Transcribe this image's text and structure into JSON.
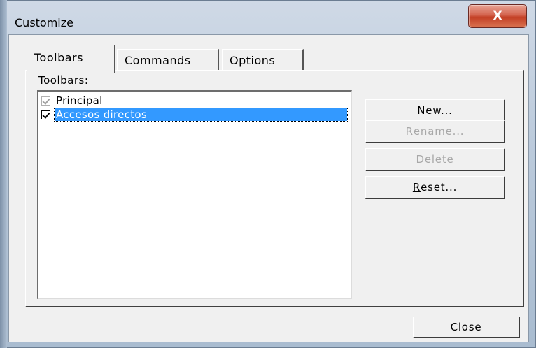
{
  "window": {
    "title": "Customize",
    "close_glyph": "X"
  },
  "tabs": [
    {
      "label": "Toolbars",
      "active": true
    },
    {
      "label": "Commands",
      "active": false
    },
    {
      "label": "Options",
      "active": false
    }
  ],
  "toolbars_panel": {
    "list_label_pre": "Toolb",
    "list_label_accel": "a",
    "list_label_post": "rs:",
    "items": [
      {
        "label": "Principal",
        "checked": true,
        "selected": false,
        "dimmed": true
      },
      {
        "label": "Accesos directos",
        "checked": true,
        "selected": true,
        "dimmed": false
      }
    ],
    "buttons": {
      "new": {
        "accel": "N",
        "rest": "ew...",
        "enabled": true
      },
      "rename": {
        "pre": "R",
        "accel": "e",
        "rest": "name...",
        "enabled": false
      },
      "delete": {
        "accel": "D",
        "rest": "elete",
        "enabled": false
      },
      "reset": {
        "accel": "R",
        "rest": "eset...",
        "enabled": true
      }
    }
  },
  "footer": {
    "close_label": "Close"
  },
  "colors": {
    "selection": "#3399ff",
    "dialog_bg": "#f0f0f0",
    "close_button_red": "#c33f25"
  }
}
